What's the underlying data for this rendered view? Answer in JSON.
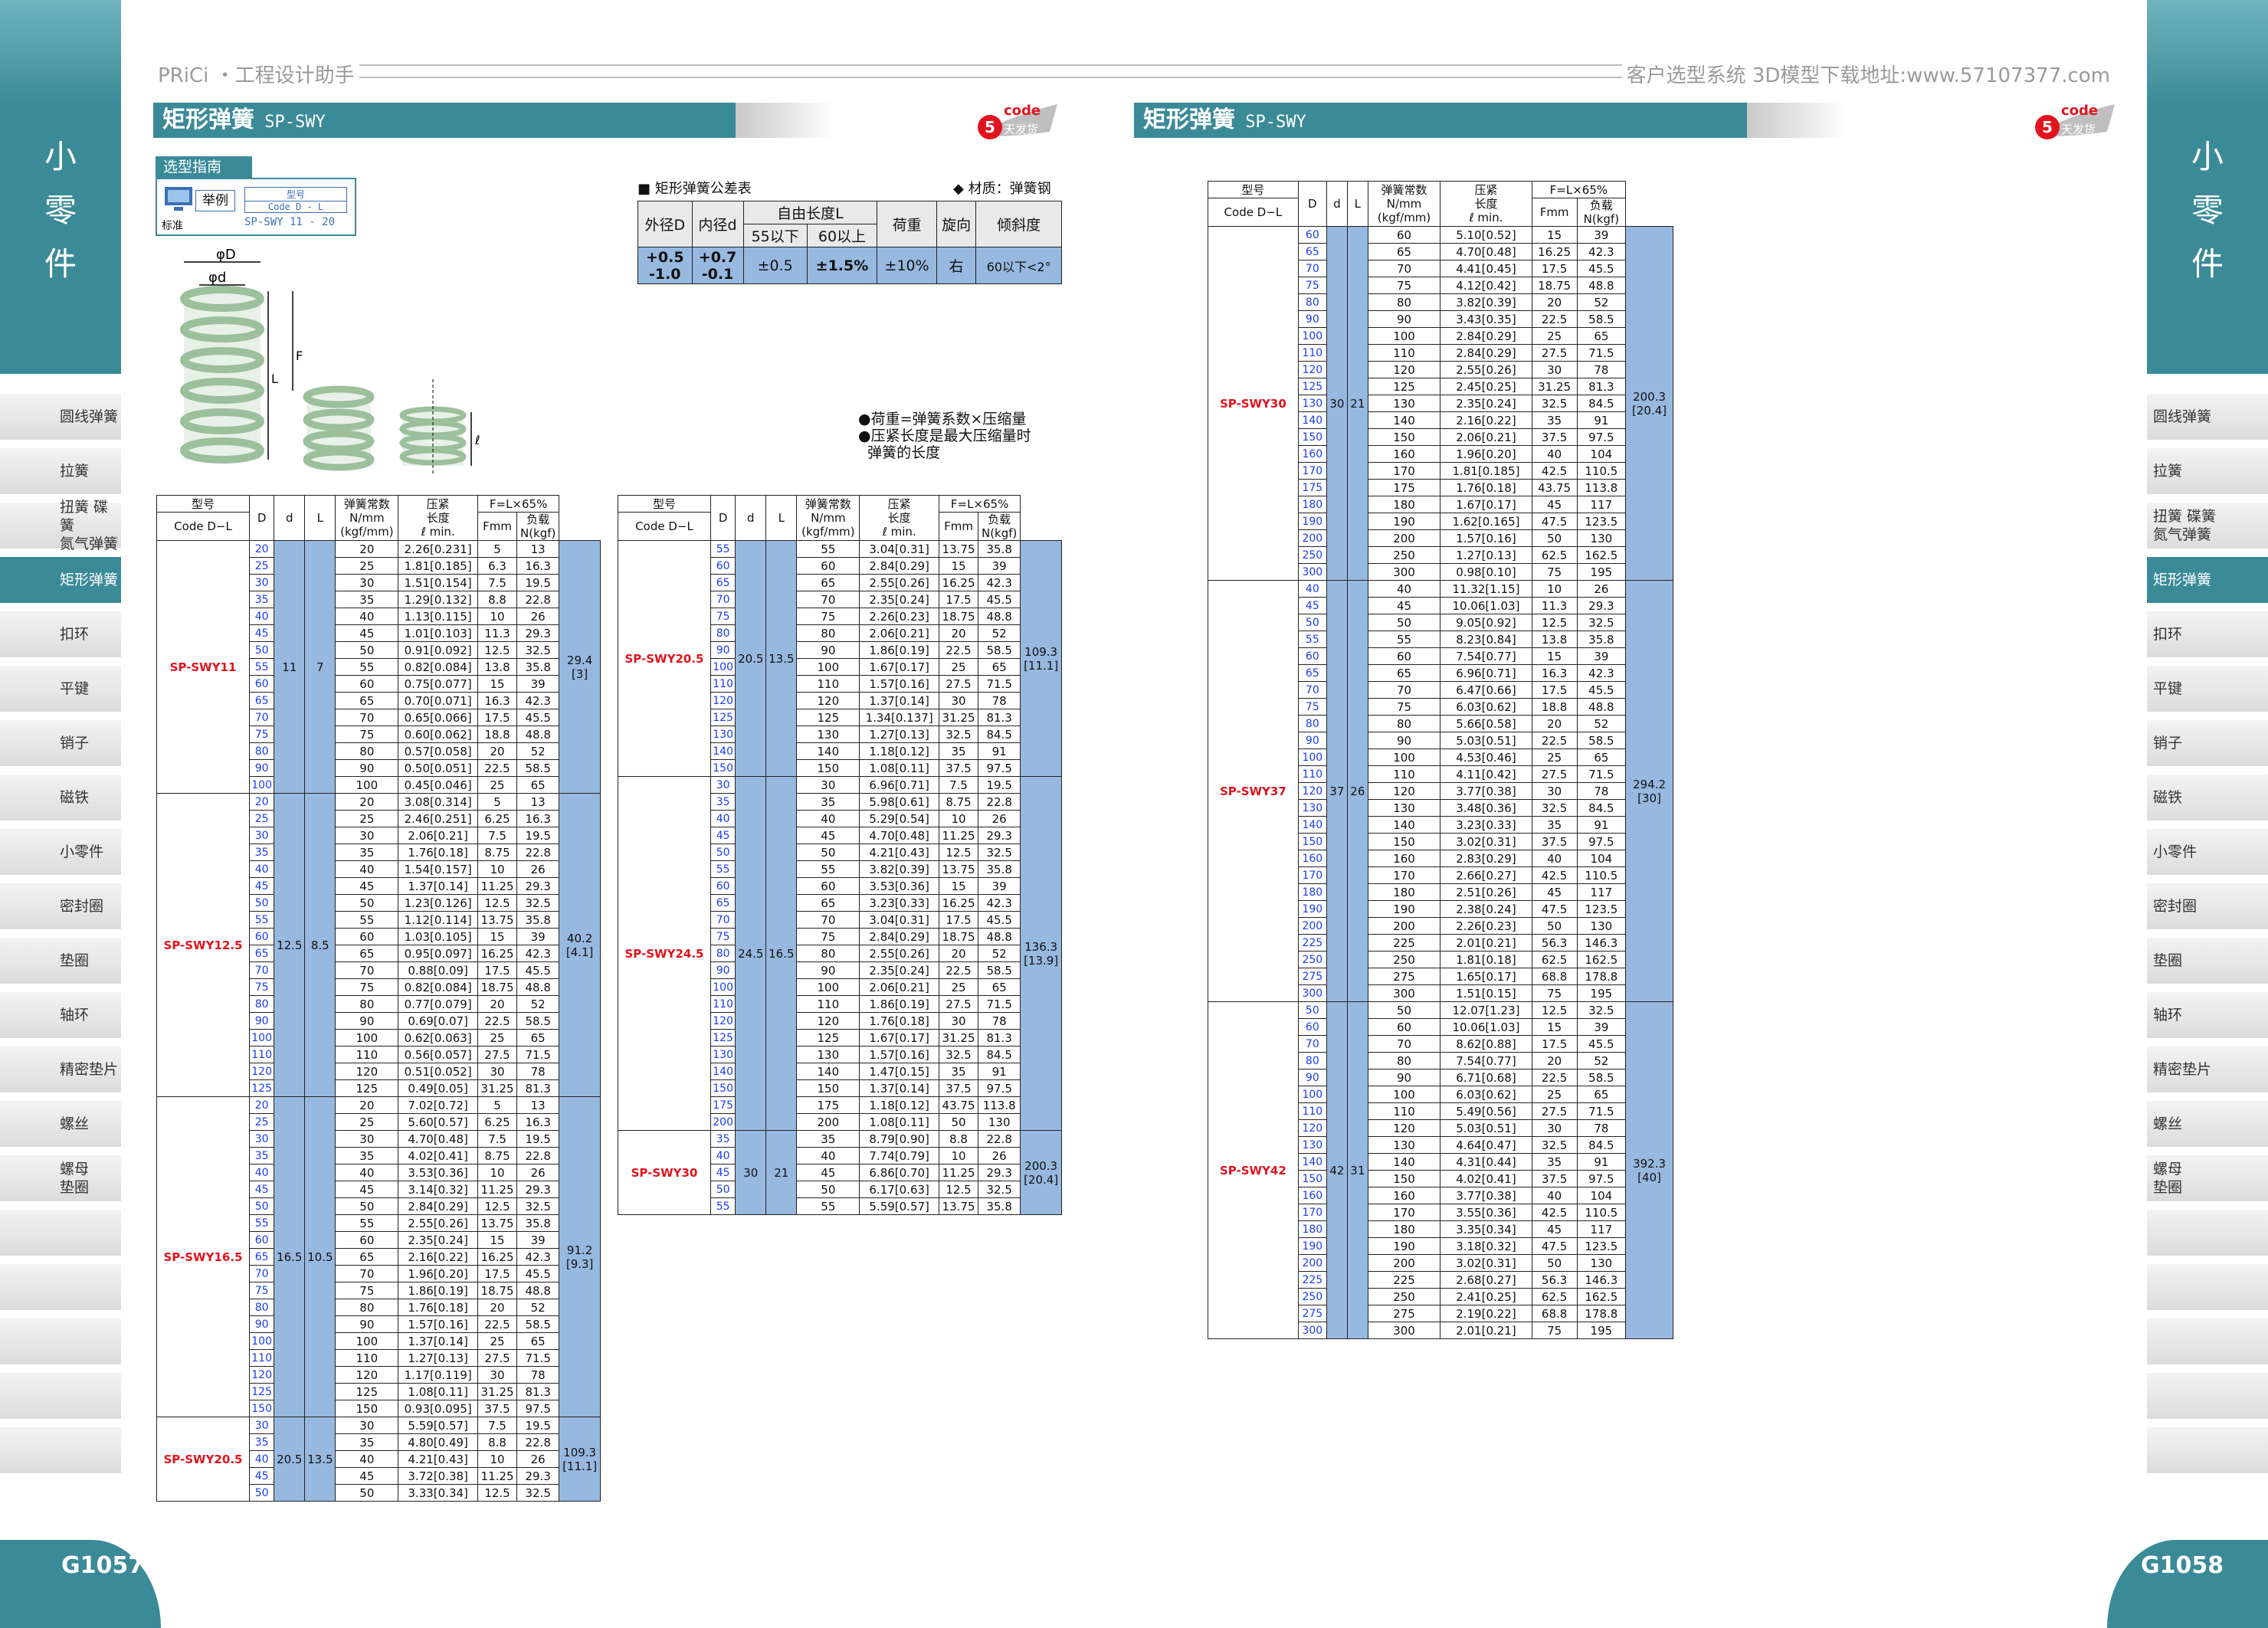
{
  "header": {
    "left": "PRiCi ・工程设计助手",
    "right": "客户选型系统 3D模型下载地址:www.57107377.com"
  },
  "side": {
    "chars": [
      "小",
      "零",
      "件"
    ]
  },
  "nav": {
    "left": [
      "圆线弹簧",
      "拉簧",
      "扭簧 碟簧\n氮气弹簧",
      "矩形弹簧",
      "扣环",
      "平键",
      "销子",
      "磁铁",
      "小零件",
      "密封圈",
      "垫圈",
      "轴环",
      "精密垫片",
      "螺丝",
      "螺母\n垫圈"
    ],
    "active": "矩形弹簧"
  },
  "titles": {
    "left": "矩形弹簧",
    "left_sub": " SP-SWY",
    "right": "矩形弹簧",
    "right_sub": " SP-SWY"
  },
  "logo": {
    "code": "code",
    "text": "天发货",
    "num": "5"
  },
  "pages": {
    "left": "G1057",
    "right": "G1058"
  },
  "guide": {
    "label": "选型指南",
    "example": "举例",
    "std": "标准",
    "head": "型号",
    "code": "Code D - L",
    "value": "SP-SWY 11 - 20"
  },
  "fig": {
    "D": "φD",
    "d": "φd",
    "F": "F",
    "L": "L",
    "l": "ℓ"
  },
  "tolerance": {
    "title": "■ 矩形弹簧公差表",
    "material": "◆ 材质：弹簧钢",
    "headers": [
      "外径D",
      "内径d",
      "自由长度L",
      "荷重",
      "旋向",
      "倾斜度"
    ],
    "sub": [
      "55以下",
      "60以上"
    ],
    "row": [
      "+0.5\n-1.0",
      "+0.7\n-0.1",
      "±0.5",
      "±1.5%",
      "±10%",
      "右",
      "60以下<2°"
    ]
  },
  "notes": [
    "●荷重=弹簧系数×压缩量",
    "●压紧长度是最大压缩量时",
    "  弹簧的长度"
  ],
  "thead": {
    "model": "型号",
    "code": "Code D−L",
    "D": "D",
    "d": "d",
    "L": "L",
    "k": "弹簧常数\nN/mm\n(kgf/mm)",
    "comp": "压紧\n长度\nℓ min.",
    "F": "F=L×65%",
    "Fmm": "Fmm",
    "load": "负载\nN(kgf)"
  },
  "groups": {
    "g11": {
      "code": "SP-SWY11",
      "D": "11",
      "d": "7",
      "load": "29.4\n[3]",
      "rows": [
        [
          "20",
          "2.26[0.231]",
          "5",
          "13"
        ],
        [
          "25",
          "1.81[0.185]",
          "6.3",
          "16.3"
        ],
        [
          "30",
          "1.51[0.154]",
          "7.5",
          "19.5"
        ],
        [
          "35",
          "1.29[0.132]",
          "8.8",
          "22.8"
        ],
        [
          "40",
          "1.13[0.115]",
          "10",
          "26"
        ],
        [
          "45",
          "1.01[0.103]",
          "11.3",
          "29.3"
        ],
        [
          "50",
          "0.91[0.092]",
          "12.5",
          "32.5"
        ],
        [
          "55",
          "0.82[0.084]",
          "13.8",
          "35.8"
        ],
        [
          "60",
          "0.75[0.077]",
          "15",
          "39"
        ],
        [
          "65",
          "0.70[0.071]",
          "16.3",
          "42.3"
        ],
        [
          "70",
          "0.65[0.066]",
          "17.5",
          "45.5"
        ],
        [
          "75",
          "0.60[0.062]",
          "18.8",
          "48.8"
        ],
        [
          "80",
          "0.57[0.058]",
          "20",
          "52"
        ],
        [
          "90",
          "0.50[0.051]",
          "22.5",
          "58.5"
        ],
        [
          "100",
          "0.45[0.046]",
          "25",
          "65"
        ]
      ]
    },
    "g125": {
      "code": "SP-SWY12.5",
      "D": "12.5",
      "d": "8.5",
      "load": "40.2\n[4.1]",
      "rows": [
        [
          "20",
          "3.08[0.314]",
          "5",
          "13"
        ],
        [
          "25",
          "2.46[0.251]",
          "6.25",
          "16.3"
        ],
        [
          "30",
          "2.06[0.21]",
          "7.5",
          "19.5"
        ],
        [
          "35",
          "1.76[0.18]",
          "8.75",
          "22.8"
        ],
        [
          "40",
          "1.54[0.157]",
          "10",
          "26"
        ],
        [
          "45",
          "1.37[0.14]",
          "11.25",
          "29.3"
        ],
        [
          "50",
          "1.23[0.126]",
          "12.5",
          "32.5"
        ],
        [
          "55",
          "1.12[0.114]",
          "13.75",
          "35.8"
        ],
        [
          "60",
          "1.03[0.105]",
          "15",
          "39"
        ],
        [
          "65",
          "0.95[0.097]",
          "16.25",
          "42.3"
        ],
        [
          "70",
          "0.88[0.09]",
          "17.5",
          "45.5"
        ],
        [
          "75",
          "0.82[0.084]",
          "18.75",
          "48.8"
        ],
        [
          "80",
          "0.77[0.079]",
          "20",
          "52"
        ],
        [
          "90",
          "0.69[0.07]",
          "22.5",
          "58.5"
        ],
        [
          "100",
          "0.62[0.063]",
          "25",
          "65"
        ],
        [
          "110",
          "0.56[0.057]",
          "27.5",
          "71.5"
        ],
        [
          "120",
          "0.51[0.052]",
          "30",
          "78"
        ],
        [
          "125",
          "0.49[0.05]",
          "31.25",
          "81.3"
        ]
      ]
    },
    "g165": {
      "code": "SP-SWY16.5",
      "D": "16.5",
      "d": "10.5",
      "load": "91.2\n[9.3]",
      "rows": [
        [
          "20",
          "7.02[0.72]",
          "5",
          "13"
        ],
        [
          "25",
          "5.60[0.57]",
          "6.25",
          "16.3"
        ],
        [
          "30",
          "4.70[0.48]",
          "7.5",
          "19.5"
        ],
        [
          "35",
          "4.02[0.41]",
          "8.75",
          "22.8"
        ],
        [
          "40",
          "3.53[0.36]",
          "10",
          "26"
        ],
        [
          "45",
          "3.14[0.32]",
          "11.25",
          "29.3"
        ],
        [
          "50",
          "2.84[0.29]",
          "12.5",
          "32.5"
        ],
        [
          "55",
          "2.55[0.26]",
          "13.75",
          "35.8"
        ],
        [
          "60",
          "2.35[0.24]",
          "15",
          "39"
        ],
        [
          "65",
          "2.16[0.22]",
          "16.25",
          "42.3"
        ],
        [
          "70",
          "1.96[0.20]",
          "17.5",
          "45.5"
        ],
        [
          "75",
          "1.86[0.19]",
          "18.75",
          "48.8"
        ],
        [
          "80",
          "1.76[0.18]",
          "20",
          "52"
        ],
        [
          "90",
          "1.57[0.16]",
          "22.5",
          "58.5"
        ],
        [
          "100",
          "1.37[0.14]",
          "25",
          "65"
        ],
        [
          "110",
          "1.27[0.13]",
          "27.5",
          "71.5"
        ],
        [
          "120",
          "1.17[0.119]",
          "30",
          "78"
        ],
        [
          "125",
          "1.08[0.11]",
          "31.25",
          "81.3"
        ],
        [
          "150",
          "0.93[0.095]",
          "37.5",
          "97.5"
        ]
      ]
    },
    "g205a": {
      "code": "SP-SWY20.5",
      "D": "20.5",
      "d": "13.5",
      "load": "109.3\n[11.1]",
      "rows": [
        [
          "30",
          "5.59[0.57]",
          "7.5",
          "19.5"
        ],
        [
          "35",
          "4.80[0.49]",
          "8.8",
          "22.8"
        ],
        [
          "40",
          "4.21[0.43]",
          "10",
          "26"
        ],
        [
          "45",
          "3.72[0.38]",
          "11.25",
          "29.3"
        ],
        [
          "50",
          "3.33[0.34]",
          "12.5",
          "32.5"
        ]
      ]
    },
    "g205b": {
      "code": "SP-SWY20.5",
      "D": "20.5",
      "d": "13.5",
      "load": "109.3\n[11.1]",
      "rows": [
        [
          "55",
          "3.04[0.31]",
          "13.75",
          "35.8"
        ],
        [
          "60",
          "2.84[0.29]",
          "15",
          "39"
        ],
        [
          "65",
          "2.55[0.26]",
          "16.25",
          "42.3"
        ],
        [
          "70",
          "2.35[0.24]",
          "17.5",
          "45.5"
        ],
        [
          "75",
          "2.26[0.23]",
          "18.75",
          "48.8"
        ],
        [
          "80",
          "2.06[0.21]",
          "20",
          "52"
        ],
        [
          "90",
          "1.86[0.19]",
          "22.5",
          "58.5"
        ],
        [
          "100",
          "1.67[0.17]",
          "25",
          "65"
        ],
        [
          "110",
          "1.57[0.16]",
          "27.5",
          "71.5"
        ],
        [
          "120",
          "1.37[0.14]",
          "30",
          "78"
        ],
        [
          "125",
          "1.34[0.137]",
          "31.25",
          "81.3"
        ],
        [
          "130",
          "1.27[0.13]",
          "32.5",
          "84.5"
        ],
        [
          "140",
          "1.18[0.12]",
          "35",
          "91"
        ],
        [
          "150",
          "1.08[0.11]",
          "37.5",
          "97.5"
        ]
      ]
    },
    "g245": {
      "code": "SP-SWY24.5",
      "D": "24.5",
      "d": "16.5",
      "load": "136.3\n[13.9]",
      "rows": [
        [
          "30",
          "6.96[0.71]",
          "7.5",
          "19.5"
        ],
        [
          "35",
          "5.98[0.61]",
          "8.75",
          "22.8"
        ],
        [
          "40",
          "5.29[0.54]",
          "10",
          "26"
        ],
        [
          "45",
          "4.70[0.48]",
          "11.25",
          "29.3"
        ],
        [
          "50",
          "4.21[0.43]",
          "12.5",
          "32.5"
        ],
        [
          "55",
          "3.82[0.39]",
          "13.75",
          "35.8"
        ],
        [
          "60",
          "3.53[0.36]",
          "15",
          "39"
        ],
        [
          "65",
          "3.23[0.33]",
          "16.25",
          "42.3"
        ],
        [
          "70",
          "3.04[0.31]",
          "17.5",
          "45.5"
        ],
        [
          "75",
          "2.84[0.29]",
          "18.75",
          "48.8"
        ],
        [
          "80",
          "2.55[0.26]",
          "20",
          "52"
        ],
        [
          "90",
          "2.35[0.24]",
          "22.5",
          "58.5"
        ],
        [
          "100",
          "2.06[0.21]",
          "25",
          "65"
        ],
        [
          "110",
          "1.86[0.19]",
          "27.5",
          "71.5"
        ],
        [
          "120",
          "1.76[0.18]",
          "30",
          "78"
        ],
        [
          "125",
          "1.67[0.17]",
          "31.25",
          "81.3"
        ],
        [
          "130",
          "1.57[0.16]",
          "32.5",
          "84.5"
        ],
        [
          "140",
          "1.47[0.15]",
          "35",
          "91"
        ],
        [
          "150",
          "1.37[0.14]",
          "37.5",
          "97.5"
        ],
        [
          "175",
          "1.18[0.12]",
          "43.75",
          "113.8"
        ],
        [
          "200",
          "1.08[0.11]",
          "50",
          "130"
        ]
      ]
    },
    "g30a": {
      "code": "SP-SWY30",
      "D": "30",
      "d": "21",
      "load": "200.3\n[20.4]",
      "rows": [
        [
          "35",
          "8.79[0.90]",
          "8.8",
          "22.8"
        ],
        [
          "40",
          "7.74[0.79]",
          "10",
          "26"
        ],
        [
          "45",
          "6.86[0.70]",
          "11.25",
          "29.3"
        ],
        [
          "50",
          "6.17[0.63]",
          "12.5",
          "32.5"
        ],
        [
          "55",
          "5.59[0.57]",
          "13.75",
          "35.8"
        ]
      ]
    },
    "g30b": {
      "code": "SP-SWY30",
      "D": "30",
      "d": "21",
      "load": "200.3\n[20.4]",
      "rows": [
        [
          "60",
          "5.10[0.52]",
          "15",
          "39"
        ],
        [
          "65",
          "4.70[0.48]",
          "16.25",
          "42.3"
        ],
        [
          "70",
          "4.41[0.45]",
          "17.5",
          "45.5"
        ],
        [
          "75",
          "4.12[0.42]",
          "18.75",
          "48.8"
        ],
        [
          "80",
          "3.82[0.39]",
          "20",
          "52"
        ],
        [
          "90",
          "3.43[0.35]",
          "22.5",
          "58.5"
        ],
        [
          "100",
          "2.84[0.29]",
          "25",
          "65"
        ],
        [
          "110",
          "2.84[0.29]",
          "27.5",
          "71.5"
        ],
        [
          "120",
          "2.55[0.26]",
          "30",
          "78"
        ],
        [
          "125",
          "2.45[0.25]",
          "31.25",
          "81.3"
        ],
        [
          "130",
          "2.35[0.24]",
          "32.5",
          "84.5"
        ],
        [
          "140",
          "2.16[0.22]",
          "35",
          "91"
        ],
        [
          "150",
          "2.06[0.21]",
          "37.5",
          "97.5"
        ],
        [
          "160",
          "1.96[0.20]",
          "40",
          "104"
        ],
        [
          "170",
          "1.81[0.185]",
          "42.5",
          "110.5"
        ],
        [
          "175",
          "1.76[0.18]",
          "43.75",
          "113.8"
        ],
        [
          "180",
          "1.67[0.17]",
          "45",
          "117"
        ],
        [
          "190",
          "1.62[0.165]",
          "47.5",
          "123.5"
        ],
        [
          "200",
          "1.57[0.16]",
          "50",
          "130"
        ],
        [
          "250",
          "1.27[0.13]",
          "62.5",
          "162.5"
        ],
        [
          "300",
          "0.98[0.10]",
          "75",
          "195"
        ]
      ]
    },
    "g37": {
      "code": "SP-SWY37",
      "D": "37",
      "d": "26",
      "load": "294.2\n[30]",
      "rows": [
        [
          "40",
          "11.32[1.15]",
          "10",
          "26"
        ],
        [
          "45",
          "10.06[1.03]",
          "11.3",
          "29.3"
        ],
        [
          "50",
          "9.05[0.92]",
          "12.5",
          "32.5"
        ],
        [
          "55",
          "8.23[0.84]",
          "13.8",
          "35.8"
        ],
        [
          "60",
          "7.54[0.77]",
          "15",
          "39"
        ],
        [
          "65",
          "6.96[0.71]",
          "16.3",
          "42.3"
        ],
        [
          "70",
          "6.47[0.66]",
          "17.5",
          "45.5"
        ],
        [
          "75",
          "6.03[0.62]",
          "18.8",
          "48.8"
        ],
        [
          "80",
          "5.66[0.58]",
          "20",
          "52"
        ],
        [
          "90",
          "5.03[0.51]",
          "22.5",
          "58.5"
        ],
        [
          "100",
          "4.53[0.46]",
          "25",
          "65"
        ],
        [
          "110",
          "4.11[0.42]",
          "27.5",
          "71.5"
        ],
        [
          "120",
          "3.77[0.38]",
          "30",
          "78"
        ],
        [
          "130",
          "3.48[0.36]",
          "32.5",
          "84.5"
        ],
        [
          "140",
          "3.23[0.33]",
          "35",
          "91"
        ],
        [
          "150",
          "3.02[0.31]",
          "37.5",
          "97.5"
        ],
        [
          "160",
          "2.83[0.29]",
          "40",
          "104"
        ],
        [
          "170",
          "2.66[0.27]",
          "42.5",
          "110.5"
        ],
        [
          "180",
          "2.51[0.26]",
          "45",
          "117"
        ],
        [
          "190",
          "2.38[0.24]",
          "47.5",
          "123.5"
        ],
        [
          "200",
          "2.26[0.23]",
          "50",
          "130"
        ],
        [
          "225",
          "2.01[0.21]",
          "56.3",
          "146.3"
        ],
        [
          "250",
          "1.81[0.18]",
          "62.5",
          "162.5"
        ],
        [
          "275",
          "1.65[0.17]",
          "68.8",
          "178.8"
        ],
        [
          "300",
          "1.51[0.15]",
          "75",
          "195"
        ]
      ]
    },
    "g42": {
      "code": "SP-SWY42",
      "D": "42",
      "d": "31",
      "load": "392.3\n[40]",
      "rows": [
        [
          "50",
          "12.07[1.23]",
          "12.5",
          "32.5"
        ],
        [
          "60",
          "10.06[1.03]",
          "15",
          "39"
        ],
        [
          "70",
          "8.62[0.88]",
          "17.5",
          "45.5"
        ],
        [
          "80",
          "7.54[0.77]",
          "20",
          "52"
        ],
        [
          "90",
          "6.71[0.68]",
          "22.5",
          "58.5"
        ],
        [
          "100",
          "6.03[0.62]",
          "25",
          "65"
        ],
        [
          "110",
          "5.49[0.56]",
          "27.5",
          "71.5"
        ],
        [
          "120",
          "5.03[0.51]",
          "30",
          "78"
        ],
        [
          "130",
          "4.64[0.47]",
          "32.5",
          "84.5"
        ],
        [
          "140",
          "4.31[0.44]",
          "35",
          "91"
        ],
        [
          "150",
          "4.02[0.41]",
          "37.5",
          "97.5"
        ],
        [
          "160",
          "3.77[0.38]",
          "40",
          "104"
        ],
        [
          "170",
          "3.55[0.36]",
          "42.5",
          "110.5"
        ],
        [
          "180",
          "3.35[0.34]",
          "45",
          "117"
        ],
        [
          "190",
          "3.18[0.32]",
          "47.5",
          "123.5"
        ],
        [
          "200",
          "3.02[0.31]",
          "50",
          "130"
        ],
        [
          "225",
          "2.68[0.27]",
          "56.3",
          "146.3"
        ],
        [
          "250",
          "2.41[0.25]",
          "62.5",
          "162.5"
        ],
        [
          "275",
          "2.19[0.22]",
          "68.8",
          "178.8"
        ],
        [
          "300",
          "2.01[0.21]",
          "75",
          "195"
        ]
      ]
    }
  },
  "colors": {
    "teal": "#3b8a98",
    "cellblue": "#97b8df",
    "code": "#e0141e"
  }
}
